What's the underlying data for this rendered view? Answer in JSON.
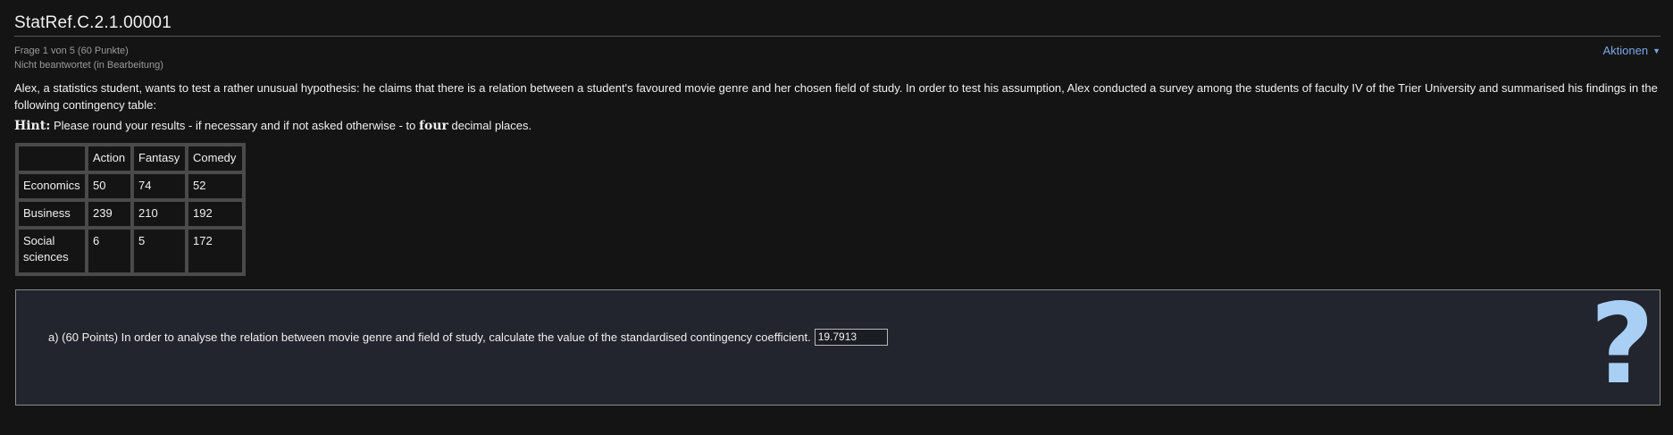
{
  "header": {
    "title": "StatRef.C.2.1.00001",
    "question_counter": "Frage 1 von 5 (60 Punkte)",
    "status": "Nicht beantwortet (in Bearbeitung)",
    "actions_label": "Aktionen",
    "actions_caret": "▼"
  },
  "question": {
    "text": "Alex, a statistics student, wants to test a rather unusual hypothesis: he claims that there is a relation between a student's favoured movie genre and her chosen field of study. In order to test his assumption, Alex conducted a survey among the students of faculty IV of the Trier University and summarised his findings in the following contingency table:",
    "hint_label": "Hint:",
    "hint_pre": "Please round your results - if necessary and if not asked otherwise - to",
    "hint_bold": "four",
    "hint_post": "decimal places."
  },
  "table": {
    "headers": [
      "",
      "Action",
      "Fantasy",
      "Comedy"
    ],
    "rows": [
      [
        "Economics",
        "50",
        "74",
        "52"
      ],
      [
        "Business",
        "239",
        "210",
        "192"
      ],
      [
        "Social sciences",
        "6",
        "5",
        "172"
      ]
    ]
  },
  "answer": {
    "prompt": "a) (60 Points) In order to analyse the relation between movie genre and field of study, calculate the value of the standardised contingency coefficient.",
    "value": "19.7913",
    "help_symbol": "?"
  },
  "colors": {
    "background": "#141414",
    "answer_panel": "#22252e",
    "link": "#7aa7e6",
    "help_icon": "#a9cff5"
  }
}
